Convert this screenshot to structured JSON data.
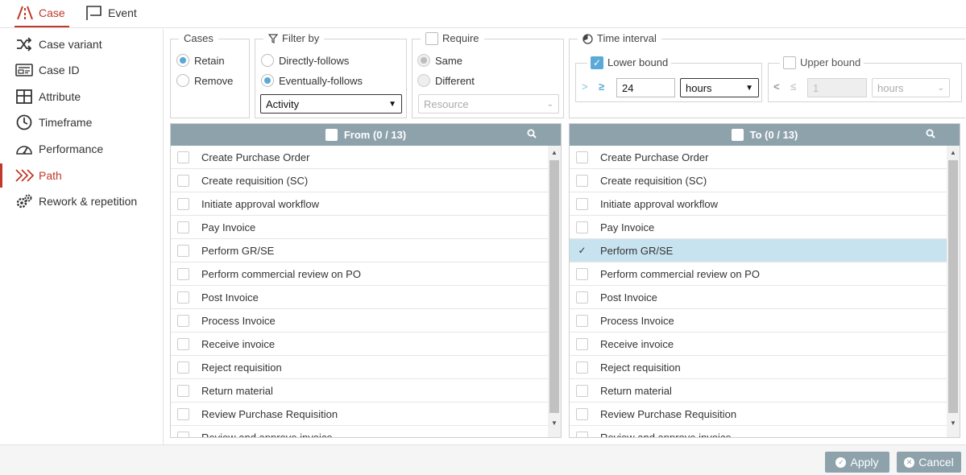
{
  "tabs": [
    {
      "label": "Case",
      "active": true,
      "icon": "road-icon"
    },
    {
      "label": "Event",
      "active": false,
      "icon": "flag-icon"
    }
  ],
  "sidebar": {
    "items": [
      {
        "label": "Case variant",
        "icon": "shuffle-icon",
        "active": false
      },
      {
        "label": "Case ID",
        "icon": "id-card-icon",
        "active": false
      },
      {
        "label": "Attribute",
        "icon": "table-icon",
        "active": false
      },
      {
        "label": "Timeframe",
        "icon": "clock-icon",
        "active": false
      },
      {
        "label": "Performance",
        "icon": "gauge-icon",
        "active": false
      },
      {
        "label": "Path",
        "icon": "chevrons-right-icon",
        "active": true
      },
      {
        "label": "Rework & repetition",
        "icon": "gears-icon",
        "active": false
      }
    ]
  },
  "cases": {
    "legend": "Cases",
    "options": [
      {
        "label": "Retain",
        "selected": true
      },
      {
        "label": "Remove",
        "selected": false
      }
    ]
  },
  "filter_by": {
    "legend": "Filter by",
    "options": [
      {
        "label": "Directly-follows",
        "selected": false
      },
      {
        "label": "Eventually-follows",
        "selected": true
      }
    ],
    "select_value": "Activity"
  },
  "require": {
    "legend": "Require",
    "checked": false,
    "options": [
      {
        "label": "Same",
        "selected": true
      },
      {
        "label": "Different",
        "selected": false
      }
    ],
    "select_placeholder": "Resource"
  },
  "time_interval": {
    "legend": "Time interval",
    "lower": {
      "label": "Lower bound",
      "checked": true,
      "op1": ">",
      "op2": "≥",
      "value": "24",
      "unit": "hours"
    },
    "upper": {
      "label": "Upper bound",
      "checked": false,
      "op1": "<",
      "op2": "≤",
      "value": "1",
      "unit": "hours"
    }
  },
  "from_list": {
    "title": "From (0 / 13)",
    "items": [
      {
        "label": "Create Purchase Order",
        "checked": false
      },
      {
        "label": "Create requisition (SC)",
        "checked": false
      },
      {
        "label": "Initiate approval workflow",
        "checked": false
      },
      {
        "label": "Pay Invoice",
        "checked": false
      },
      {
        "label": "Perform GR/SE",
        "checked": false
      },
      {
        "label": "Perform commercial review on PO",
        "checked": false
      },
      {
        "label": "Post Invoice",
        "checked": false
      },
      {
        "label": "Process Invoice",
        "checked": false
      },
      {
        "label": "Receive invoice",
        "checked": false
      },
      {
        "label": "Reject requisition",
        "checked": false
      },
      {
        "label": "Return material",
        "checked": false
      },
      {
        "label": "Review Purchase Requisition",
        "checked": false
      },
      {
        "label": "Review and approve invoice",
        "checked": false
      }
    ]
  },
  "to_list": {
    "title": "To (0 / 13)",
    "items": [
      {
        "label": "Create Purchase Order",
        "checked": false
      },
      {
        "label": "Create requisition (SC)",
        "checked": false
      },
      {
        "label": "Initiate approval workflow",
        "checked": false
      },
      {
        "label": "Pay Invoice",
        "checked": false
      },
      {
        "label": "Perform GR/SE",
        "checked": true
      },
      {
        "label": "Perform commercial review on PO",
        "checked": false
      },
      {
        "label": "Post Invoice",
        "checked": false
      },
      {
        "label": "Process Invoice",
        "checked": false
      },
      {
        "label": "Receive invoice",
        "checked": false
      },
      {
        "label": "Reject requisition",
        "checked": false
      },
      {
        "label": "Return material",
        "checked": false
      },
      {
        "label": "Review Purchase Requisition",
        "checked": false
      },
      {
        "label": "Review and approve invoice",
        "checked": false
      }
    ]
  },
  "footer": {
    "apply_label": "Apply",
    "cancel_label": "Cancel"
  },
  "colors": {
    "accent": "#c0392b",
    "header": "#8ea2ac",
    "radio": "#5aa9d6",
    "selected_row": "#c8e3f0"
  }
}
